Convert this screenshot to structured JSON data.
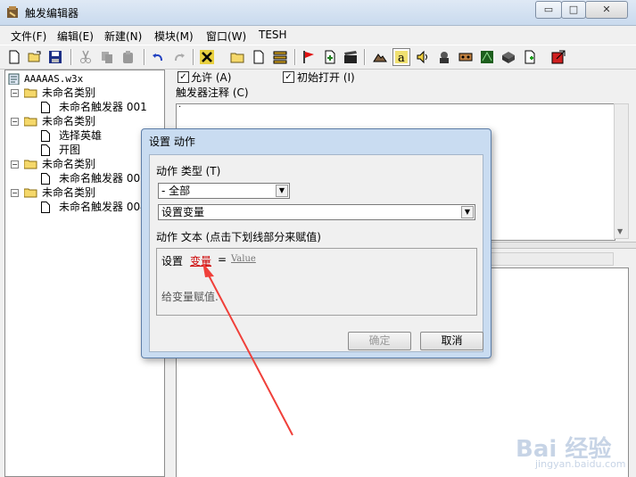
{
  "window": {
    "title": "触发编辑器",
    "controls": {
      "minimize": "▭",
      "maximize": "□",
      "close": "✕"
    }
  },
  "menu": [
    "文件(F)",
    "编辑(E)",
    "新建(N)",
    "模块(M)",
    "窗口(W)",
    "TESH"
  ],
  "toolbar": {
    "buttons": [
      "new-file-icon",
      "open-folder-icon",
      "save-icon",
      "cut-icon",
      "copy-icon",
      "paste-icon",
      "undo-icon",
      "redo-icon",
      "delete-icon",
      "new-category-icon",
      "new-trigger-icon",
      "new-comment-icon",
      "test-map-icon",
      "import-icon",
      "clapper-icon",
      "terrain-icon",
      "text-icon",
      "sound-icon",
      "unit-icon",
      "object-icon",
      "cliff-icon",
      "camera-icon",
      "new-document-icon",
      "exit-icon"
    ]
  },
  "tree": {
    "root": "AAAAAS.w3x",
    "categories": [
      {
        "label": "未命名类别",
        "children": [
          "未命名触发器 001"
        ]
      },
      {
        "label": "未命名类别",
        "children": [
          "选择英雄",
          "开图"
        ]
      },
      {
        "label": "未命名类别",
        "children": [
          "未命名触发器 003"
        ]
      },
      {
        "label": "未命名类别",
        "children": [
          "未命名触发器 004"
        ]
      }
    ]
  },
  "trigger": {
    "enabled_label": "允许 (A)",
    "initially_on_label": "初始打开 (I)",
    "comment_label": "触发器注释 (C)",
    "comment_value": "·"
  },
  "dialog": {
    "title": "设置 动作",
    "type_label": "动作 类型 (T)",
    "type_value": "- 全部",
    "action_value": "设置变量",
    "text_label": "动作 文本 (点击下划线部分来赋值)",
    "text_prefix": "设置",
    "var_link": "变量",
    "equals": "=",
    "value_link": "Value",
    "description": "给变量赋值.",
    "ok": "确定",
    "cancel": "取消",
    "var_link_color": "#cc0000"
  },
  "watermark": {
    "text": "Bai 经验",
    "url": "jingyan.baidu.com"
  }
}
